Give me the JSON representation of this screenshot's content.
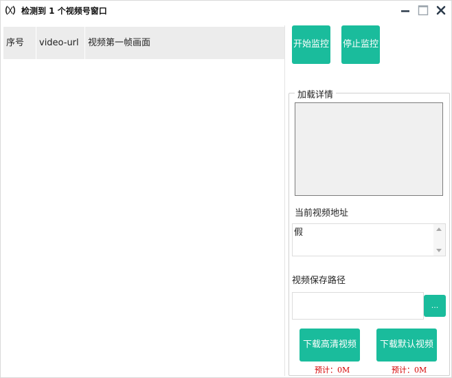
{
  "window": {
    "title": "检测到 1 个视频号窗口",
    "app_icon": "bracket-logo-icon",
    "controls": [
      "minimize-icon",
      "maximize-icon",
      "close-icon"
    ]
  },
  "table": {
    "columns": [
      "序号",
      "video-url",
      "视频第一帧画面"
    ],
    "rows": []
  },
  "controls": {
    "start_label": "开始监控",
    "stop_label": "停止监控"
  },
  "details": {
    "group_label": "加载详情",
    "current_url_label": "当前视频地址",
    "current_url_value": "假",
    "save_path_label": "视频保存路径",
    "save_path_value": "",
    "browse_label": "...",
    "download_hd_label": "下载高清视频",
    "download_default_label": "下载默认视频",
    "estimate_hd": "预计：0M",
    "estimate_default": "预计：0M"
  },
  "colors": {
    "accent": "#1abc9c",
    "estimate_text": "#d40000",
    "header_bg": "#ececec"
  }
}
